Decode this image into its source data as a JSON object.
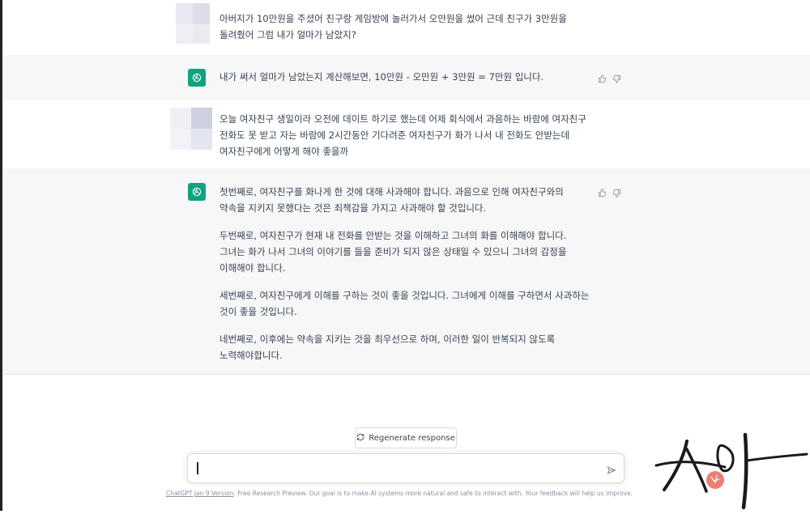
{
  "conversation": [
    {
      "role": "user",
      "text": "아버지가 10만원을 주셨어 친구랑 게임방에 놀러가서 오만원을 썼어 근데 친구가 3만원을 돌려줬어 그럼 내가 얼마가 남았지?"
    },
    {
      "role": "assistant",
      "paragraphs": [
        "내가 써서 얼마가 남았는지 계산해보면, 10만원 - 오만원 + 3만원 = 7만원 입니다."
      ]
    },
    {
      "role": "user",
      "text": "오늘 여자친구 생일이라 오전에 데이트 하기로 했는데 어제 회식에서 과음하는 바람에 여자친구 전화도 못 받고 자는 바람에 2시간동안 기다려준 여자친구가 화가 나서 내 전화도 안받는데 여자친구에게 어떻게 해야 좋을까"
    },
    {
      "role": "assistant",
      "paragraphs": [
        "첫번째로, 여자친구를 화나게 한 것에 대해 사과해야 합니다. 과음으로 인해 여자친구와의 약속을 지키지 못했다는 것은 죄책감을 가지고 사과해야 할 것입니다.",
        "두번째로, 여자친구가 현재 내 전화를 안받는 것을 이해하고 그녀의 화를 이해해야 합니다. 그녀는 화가 나서 그녀의 이야기를 들을 준비가 되지 않은 상태일 수 있으니 그녀의 감정을 이해해야 합니다.",
        "세번째로, 여자친구에게 이해를 구하는 것이 좋을 것입니다. 그녀에게 이해를 구하면서 사과하는 것이 좋을 것입니다.",
        "네번째로, 이후에는 약속을 지키는 것을 최우선으로 하며, 이러한 일이 반복되지 않도록 노력해야합니다."
      ]
    }
  ],
  "regenerate": {
    "label": "Regenerate response",
    "icon": "refresh-icon"
  },
  "input": {
    "placeholder": "",
    "send_icon": "send-icon"
  },
  "footer": {
    "link": "ChatGPT Jan 9 Version",
    "text": ". Free Research Preview. Our goal is to make AI systems more natural and safe to interact with. Your feedback will help us improve."
  },
  "colors": {
    "brand": "#10a37f",
    "assistant_bg": "#f7f7f8",
    "sidebar": "#202123",
    "text": "#374151"
  },
  "signature": {
    "text": "시아"
  }
}
